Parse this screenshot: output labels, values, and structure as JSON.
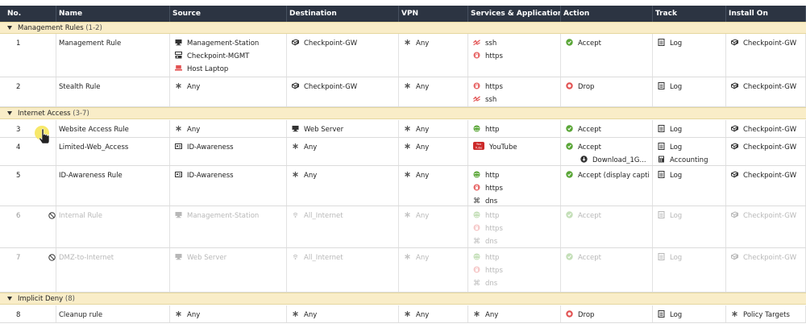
{
  "columns": [
    "No.",
    "Name",
    "Source",
    "Destination",
    "VPN",
    "Services & Applications",
    "Action",
    "Track",
    "Install On"
  ],
  "colors": {
    "header_bg": "#2c3442",
    "section_bg": "#f9edc8",
    "accept_green": "#5aa637",
    "drop_red": "#e25353"
  },
  "sections": [
    {
      "title": "Management Rules",
      "range": "(1-2)"
    },
    {
      "title": "Internet Access",
      "range": "(3-7)"
    },
    {
      "title": "Implicit Deny",
      "range": "(8)"
    }
  ],
  "rules": [
    {
      "no": "1",
      "name": "Management Rule",
      "disabled": false,
      "source": [
        {
          "icon": "host-icon",
          "text": "Management-Station"
        },
        {
          "icon": "gateway-mgmt-icon",
          "text": "Checkpoint-MGMT"
        },
        {
          "icon": "laptop-icon",
          "text": "Host Laptop"
        }
      ],
      "destination": [
        {
          "icon": "gateway-icon",
          "text": "Checkpoint-GW"
        }
      ],
      "vpn": [
        {
          "icon": "any-icon",
          "text": "Any"
        }
      ],
      "services": [
        {
          "icon": "ssh-icon",
          "text": "ssh"
        },
        {
          "icon": "https-icon",
          "text": "https"
        }
      ],
      "action": [
        {
          "icon": "accept-icon",
          "text": "Accept"
        }
      ],
      "track": [
        {
          "icon": "log-icon",
          "text": "Log"
        }
      ],
      "install_on": [
        {
          "icon": "gateway-icon",
          "text": "Checkpoint-GW"
        }
      ]
    },
    {
      "no": "2",
      "name": "Stealth Rule",
      "disabled": false,
      "source": [
        {
          "icon": "any-icon",
          "text": "Any"
        }
      ],
      "destination": [
        {
          "icon": "gateway-icon",
          "text": "Checkpoint-GW"
        }
      ],
      "vpn": [
        {
          "icon": "any-icon",
          "text": "Any"
        }
      ],
      "services": [
        {
          "icon": "https-icon",
          "text": "https"
        },
        {
          "icon": "ssh-icon",
          "text": "ssh"
        }
      ],
      "action": [
        {
          "icon": "drop-icon",
          "text": "Drop"
        }
      ],
      "track": [
        {
          "icon": "log-icon",
          "text": "Log"
        }
      ],
      "install_on": [
        {
          "icon": "gateway-icon",
          "text": "Checkpoint-GW"
        }
      ]
    },
    {
      "no": "3",
      "name": "Website Access Rule",
      "disabled": false,
      "source": [
        {
          "icon": "any-icon",
          "text": "Any"
        }
      ],
      "destination": [
        {
          "icon": "host-icon",
          "text": "Web Server"
        }
      ],
      "vpn": [
        {
          "icon": "any-icon",
          "text": "Any"
        }
      ],
      "services": [
        {
          "icon": "http-icon",
          "text": "http"
        }
      ],
      "action": [
        {
          "icon": "accept-icon",
          "text": "Accept"
        }
      ],
      "track": [
        {
          "icon": "log-icon",
          "text": "Log"
        }
      ],
      "install_on": [
        {
          "icon": "gateway-icon",
          "text": "Checkpoint-GW"
        }
      ]
    },
    {
      "no": "4",
      "name": "Limited-Web_Access",
      "disabled": false,
      "source": [
        {
          "icon": "id-card-icon",
          "text": "ID-Awareness"
        }
      ],
      "destination": [
        {
          "icon": "any-icon",
          "text": "Any"
        }
      ],
      "vpn": [
        {
          "icon": "any-icon",
          "text": "Any"
        }
      ],
      "services": [
        {
          "icon": "youtube-icon",
          "text": "YouTube"
        }
      ],
      "action": [
        {
          "icon": "accept-icon",
          "text": "Accept"
        },
        {
          "icon": "download-icon",
          "text": "Download_1G..."
        }
      ],
      "track": [
        {
          "icon": "log-icon",
          "text": "Log"
        },
        {
          "icon": "accounting-icon",
          "text": "Accounting"
        }
      ],
      "install_on": [
        {
          "icon": "gateway-icon",
          "text": "Checkpoint-GW"
        }
      ]
    },
    {
      "no": "5",
      "name": "ID-Awareness Rule",
      "disabled": false,
      "source": [
        {
          "icon": "id-card-icon",
          "text": "ID-Awareness"
        }
      ],
      "destination": [
        {
          "icon": "any-icon",
          "text": "Any"
        }
      ],
      "vpn": [
        {
          "icon": "any-icon",
          "text": "Any"
        }
      ],
      "services": [
        {
          "icon": "http-icon",
          "text": "http"
        },
        {
          "icon": "https-icon",
          "text": "https"
        },
        {
          "icon": "dns-icon",
          "text": "dns"
        }
      ],
      "action": [
        {
          "icon": "accept-icon",
          "text": "Accept (display capti"
        }
      ],
      "track": [
        {
          "icon": "log-icon",
          "text": "Log"
        }
      ],
      "install_on": [
        {
          "icon": "gateway-icon",
          "text": "Checkpoint-GW"
        }
      ]
    },
    {
      "no": "6",
      "name": "Internal Rule",
      "disabled": true,
      "source": [
        {
          "icon": "host-icon",
          "text": "Management-Station"
        }
      ],
      "destination": [
        {
          "icon": "internet-icon",
          "text": "All_Internet"
        }
      ],
      "vpn": [
        {
          "icon": "any-icon",
          "text": "Any"
        }
      ],
      "services": [
        {
          "icon": "http-icon",
          "text": "http"
        },
        {
          "icon": "https-icon",
          "text": "https"
        },
        {
          "icon": "dns-icon",
          "text": "dns"
        }
      ],
      "action": [
        {
          "icon": "accept-icon",
          "text": "Accept"
        }
      ],
      "track": [
        {
          "icon": "log-icon",
          "text": "Log"
        }
      ],
      "install_on": [
        {
          "icon": "gateway-icon",
          "text": "Checkpoint-GW"
        }
      ]
    },
    {
      "no": "7",
      "name": "DMZ-to-Internet",
      "disabled": true,
      "source": [
        {
          "icon": "host-icon",
          "text": "Web Server"
        }
      ],
      "destination": [
        {
          "icon": "internet-icon",
          "text": "All_Internet"
        }
      ],
      "vpn": [
        {
          "icon": "any-icon",
          "text": "Any"
        }
      ],
      "services": [
        {
          "icon": "http-icon",
          "text": "http"
        },
        {
          "icon": "https-icon",
          "text": "https"
        },
        {
          "icon": "dns-icon",
          "text": "dns"
        }
      ],
      "action": [
        {
          "icon": "accept-icon",
          "text": "Accept"
        }
      ],
      "track": [
        {
          "icon": "log-icon",
          "text": "Log"
        }
      ],
      "install_on": [
        {
          "icon": "gateway-icon",
          "text": "Checkpoint-GW"
        }
      ]
    },
    {
      "no": "8",
      "name": "Cleanup rule",
      "disabled": false,
      "source": [
        {
          "icon": "any-icon",
          "text": "Any"
        }
      ],
      "destination": [
        {
          "icon": "any-icon",
          "text": "Any"
        }
      ],
      "vpn": [
        {
          "icon": "any-icon",
          "text": "Any"
        }
      ],
      "services": [
        {
          "icon": "any-icon",
          "text": "Any"
        }
      ],
      "action": [
        {
          "icon": "drop-icon",
          "text": "Drop"
        }
      ],
      "track": [
        {
          "icon": "log-icon",
          "text": "Log"
        }
      ],
      "install_on": [
        {
          "icon": "any-icon",
          "text": "Policy Targets"
        }
      ]
    }
  ]
}
